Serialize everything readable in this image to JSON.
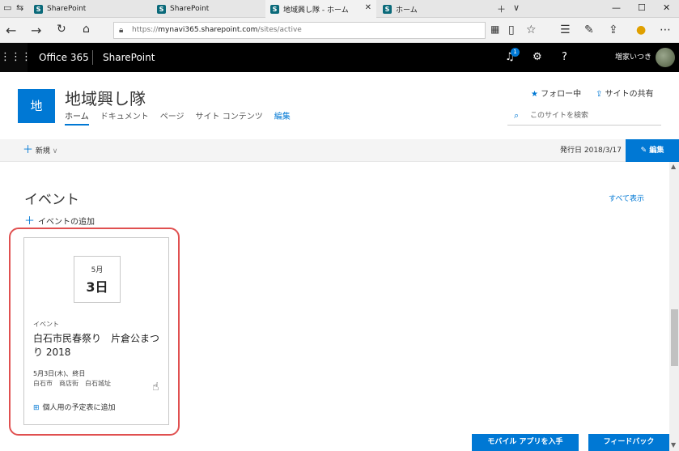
{
  "browser": {
    "tabs": [
      {
        "label": "SharePoint"
      },
      {
        "label": "SharePoint"
      },
      {
        "label": "地域興し隊 - ホーム"
      },
      {
        "label": "ホーム"
      }
    ],
    "url_prefix": "https://",
    "url_host": "mynavi365.sharepoint.com",
    "url_path": "/sites/active"
  },
  "suite": {
    "app_name": "Office 365",
    "product": "SharePoint",
    "notification_count": "1",
    "help": "?",
    "user_name": "増家いつき"
  },
  "site": {
    "logo_text": "地",
    "title": "地域興し隊",
    "nav": [
      "ホーム",
      "ドキュメント",
      "ページ",
      "サイト コンテンツ",
      "編集"
    ],
    "follow_label": "フォロー中",
    "share_label": "サイトの共有",
    "search_placeholder": "このサイトを検索"
  },
  "command_bar": {
    "new_label": "新規",
    "published": "発行日 2018/3/17",
    "edit_label": "編集"
  },
  "events": {
    "heading": "イベント",
    "see_all": "すべて表示",
    "add_event": "イベントの追加",
    "cards": [
      {
        "month": "5月",
        "day": "3日",
        "category": "イベント",
        "title": "白石市民春祭り　片倉公まつり 2018",
        "when": "5月3日(木)、終日",
        "where": "白石市　商店街　白石城址",
        "add_calendar": "個人用の予定表に追加"
      }
    ]
  },
  "footer": {
    "mobile_app": "モバイル アプリを入手",
    "feedback": "フィードバック"
  },
  "colors": {
    "accent": "#0078d4",
    "suite_bar": "#000000",
    "highlight": "#e05050"
  }
}
